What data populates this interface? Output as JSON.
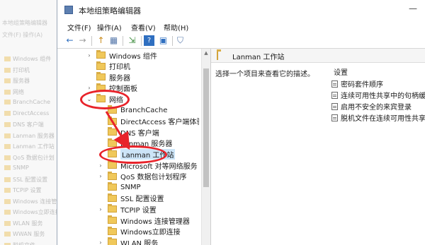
{
  "background_window": {
    "title": "本地组策略编辑器",
    "menu": "文件(F)  操作(A)",
    "items": [
      "Windows 组件",
      "打印机",
      "服务器",
      "网络",
      "BranchCache",
      "DirectAccess",
      "DNS 客户端",
      "Lanman 服务器",
      "Lanman 工作站",
      "QoS 数据包计划",
      "SNMP",
      "SSL 配置设置",
      "TCPIP 设置",
      "Windows 连接管理",
      "Windows立即连接",
      "WLAN 服务",
      "WWAN 服务",
      "脱机文件"
    ]
  },
  "window": {
    "title": "本地组策略编辑器",
    "minimize": "—"
  },
  "menu": [
    "文件(F)",
    "操作(A)",
    "查看(V)",
    "帮助(H)"
  ],
  "toolbar": {
    "back": "←",
    "forward": "→",
    "up": "↑",
    "show_hide": "▦",
    "export": "⇲",
    "help": "?",
    "properties": "▣",
    "filter": "⛉"
  },
  "tree": [
    {
      "label": "Windows 组件",
      "expander": "›",
      "level": 0
    },
    {
      "label": "打印机",
      "expander": "",
      "level": 0
    },
    {
      "label": "服务器",
      "expander": "",
      "level": 0
    },
    {
      "label": "控制面板",
      "expander": "›",
      "level": 0
    },
    {
      "label": "网络",
      "expander": "⌄",
      "level": 0
    },
    {
      "label": "BranchCache",
      "expander": "",
      "level": 1
    },
    {
      "label": "DirectAccess 客户端体验设",
      "expander": "",
      "level": 1
    },
    {
      "label": "DNS 客户端",
      "expander": "",
      "level": 1
    },
    {
      "label": "Lanman 服务器",
      "expander": "",
      "level": 1
    },
    {
      "label": "Lanman 工作站",
      "expander": "",
      "level": 1,
      "selected": true
    },
    {
      "label": "Microsoft 对等网络服务",
      "expander": "›",
      "level": 1
    },
    {
      "label": "QoS 数据包计划程序",
      "expander": "›",
      "level": 1
    },
    {
      "label": "SNMP",
      "expander": "",
      "level": 1
    },
    {
      "label": "SSL 配置设置",
      "expander": "",
      "level": 1
    },
    {
      "label": "TCPIP 设置",
      "expander": "›",
      "level": 1
    },
    {
      "label": "Windows 连接管理器",
      "expander": "",
      "level": 1
    },
    {
      "label": "Windows立即连接",
      "expander": "",
      "level": 1
    },
    {
      "label": "WLAN 服务",
      "expander": "›",
      "level": 1
    }
  ],
  "right_pane": {
    "header": "Lanman 工作站",
    "description": "选择一个项目来查看它的描述。",
    "settings_title": "设置",
    "settings": [
      "密码套件顺序",
      "连续可用性共享中的句柄缓存",
      "启用不安全的来宾登录",
      "脱机文件在连续可用性共享中"
    ]
  },
  "annotations": {
    "color": "#e8232a",
    "arrow_direction": "down-right"
  },
  "colors": {
    "folder": "#f0c85a",
    "selection": "#cce4f7",
    "highlight": "#e8232a"
  }
}
